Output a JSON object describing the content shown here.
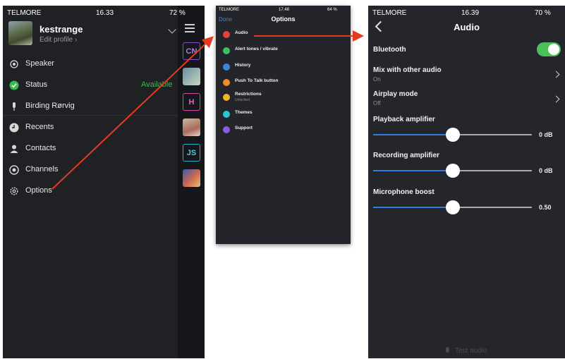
{
  "panel1": {
    "statusbar": {
      "carrier": "TELMORE",
      "time": "16.33",
      "battery": "72 %"
    },
    "profile": {
      "name": "kestrange",
      "sub": "Edit profile ›"
    },
    "menu": [
      {
        "label": "Speaker",
        "icon": "speaker-icon"
      },
      {
        "label": "Status",
        "icon": "check-circle-icon",
        "right": "Available"
      },
      {
        "label": "Birding Rørvig",
        "icon": "microphone-icon"
      },
      {
        "label": "Recents",
        "icon": "clock-icon"
      },
      {
        "label": "Contacts",
        "icon": "person-icon"
      },
      {
        "label": "Channels",
        "icon": "radio-button-icon"
      },
      {
        "label": "Options",
        "icon": "gear-icon"
      }
    ],
    "rail": [
      {
        "text": "CN",
        "color": "#8a4bd8"
      },
      {
        "text": "",
        "color": "#9fc8d8"
      },
      {
        "text": "H",
        "color": "#d447a8"
      },
      {
        "text": "",
        "color": "#b07070"
      },
      {
        "text": "JS",
        "color": "#23b0c9"
      },
      {
        "text": "",
        "color": "#d06a50"
      }
    ]
  },
  "panel2": {
    "statusbar": {
      "carrier": "TELMORE",
      "time": "17.48",
      "battery": "64 %"
    },
    "done": "Done",
    "title": "Options",
    "rows": [
      {
        "label": "Audio",
        "color": "#e0453a",
        "icon": "speaker-icon"
      },
      {
        "label": "Alert tones / vibrate",
        "color": "#3fbf5a",
        "icon": "waveform-icon"
      },
      {
        "label": "History",
        "color": "#3a86d6",
        "icon": "history-icon"
      },
      {
        "label": "Push To Talk button",
        "color": "#f08a2a",
        "icon": "ptt-icon"
      },
      {
        "label": "Restrictions",
        "sub": "Unlocked",
        "color": "#f0b429",
        "icon": "lock-icon"
      },
      {
        "label": "Themes",
        "color": "#2fc3d8",
        "icon": "palette-icon"
      },
      {
        "label": "Support",
        "color": "#8a5be0",
        "icon": "lifebuoy-icon"
      }
    ]
  },
  "panel3": {
    "statusbar": {
      "carrier": "TELMORE",
      "time": "16.39",
      "battery": "70 %"
    },
    "title": "Audio",
    "bluetooth": {
      "label": "Bluetooth",
      "on": true
    },
    "mix": {
      "label": "Mix with other audio",
      "sub": "On"
    },
    "airplay": {
      "label": "Airplay mode",
      "sub": "Off"
    },
    "playback": {
      "label": "Playback amplifier",
      "value": "0 dB",
      "fraction": 0.5
    },
    "recording": {
      "label": "Recording amplifier",
      "value": "0 dB",
      "fraction": 0.5
    },
    "boost": {
      "label": "Microphone boost",
      "value": "0.50",
      "fraction": 0.5
    },
    "test": "Test audio"
  },
  "colors": {
    "accent": "#2f7de1",
    "toggle": "#4bc15a",
    "arrow": "#e63a1f"
  }
}
